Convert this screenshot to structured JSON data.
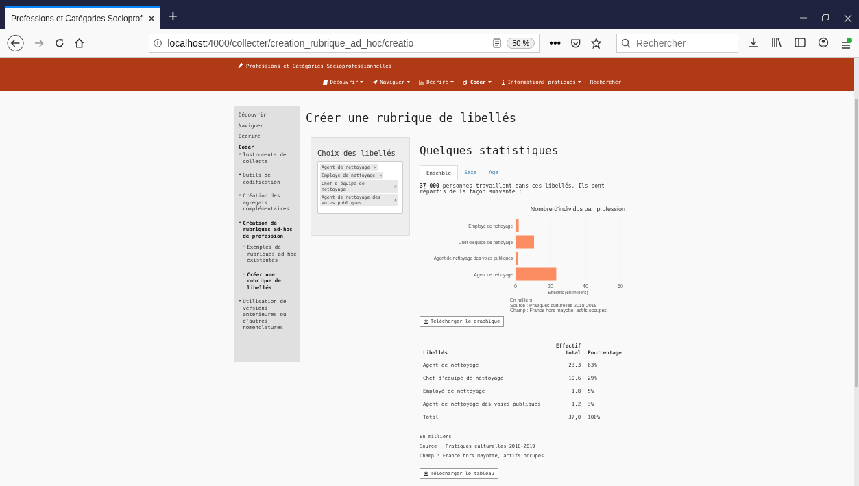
{
  "browser": {
    "tab_title": "Professions et Catégories Socioprof",
    "new_tab": "+",
    "url_host": "localhost",
    "url_rest": ":4000/collecter/creation_rubrique_ad_hoc/creatio",
    "zoom": "50 %",
    "more": "•••",
    "search": {
      "placeholder": "Rechercher"
    }
  },
  "header": {
    "brand": "Professions et Catégories Socioprofessionnelles",
    "nav": [
      {
        "label": "Découvrir",
        "kind": "book",
        "dropdown": true,
        "selected": false
      },
      {
        "label": "Naviguer",
        "kind": "send",
        "dropdown": true,
        "selected": false
      },
      {
        "label": "Décrire",
        "kind": "chart",
        "dropdown": true,
        "selected": false
      },
      {
        "label": "Coder",
        "kind": "gears",
        "dropdown": true,
        "selected": true
      },
      {
        "label": "Informations pratiques",
        "kind": "info",
        "dropdown": true,
        "selected": false
      },
      {
        "label": "Rechercher",
        "kind": "none",
        "dropdown": false,
        "selected": false
      }
    ]
  },
  "sidebar": {
    "items": [
      {
        "label": "Découvrir",
        "selected": false
      },
      {
        "label": "Naviguer",
        "selected": false
      },
      {
        "label": "Décrire",
        "selected": false
      },
      {
        "label": "Coder",
        "selected": true,
        "children": [
          {
            "bullet": "•",
            "label": "Instruments de collecte",
            "selected": false
          },
          {
            "bullet": "•",
            "label": "Outils de codification",
            "selected": false
          },
          {
            "bullet": "•",
            "label": "Création des agrégats complémentaires",
            "selected": false
          },
          {
            "bullet": "•",
            "label": "Création de rubriques ad-hoc de profession",
            "selected": true,
            "children": [
              {
                "bullet": "◦",
                "label": "Exemples de rubriques ad hoc existantes",
                "selected": false
              },
              {
                "bullet": "◦",
                "label": "Créer une rubrique de libellés",
                "selected": true
              }
            ]
          },
          {
            "bullet": "•",
            "label": "Utilisation de versions antérieures ou d'autres nomenclatures",
            "selected": false
          }
        ]
      }
    ]
  },
  "page_title": "Créer une rubrique de libellés",
  "choice_panel": {
    "title": "Choix des libellés",
    "tags": [
      {
        "label": "Agent de nettoyage",
        "remove": "×"
      },
      {
        "label": "Employé de nettoyage",
        "remove": "×"
      },
      {
        "label": "Chef d'équipe de nettoyage",
        "remove": "×"
      },
      {
        "label": "Agent de nettoyage des voies publiques",
        "remove": "×"
      }
    ]
  },
  "stats": {
    "title": "Quelques statistiques",
    "tabs": [
      {
        "label": "Ensemble",
        "selected": true
      },
      {
        "label": "Sexe",
        "selected": false
      },
      {
        "label": "Age",
        "selected": false
      }
    ],
    "summary": "**37 000** personnes travaillent dans ces libellés. Ils sont répartis de la façon suivante :",
    "chart_data": {
      "type": "bar",
      "orientation": "horizontal",
      "title": "Nombre d'individus par  profession",
      "xlabel": "Effectifs (en milliers)",
      "categories": [
        "Employé de nettoyage",
        "Chef d'équipe de nettoyage",
        "Agent de nettoyage des voies publiques",
        "Agent de nettoyage"
      ],
      "series": [
        {
          "color": "#fc8d62",
          "values": [
            1.8,
            10.6,
            1.2,
            23.3
          ]
        }
      ],
      "xlim": [
        0,
        60
      ],
      "xticks": [
        0,
        20,
        40,
        60
      ]
    },
    "chart_notes": [
      "En milliers",
      "Source : Pratiques culturelles 2018-2019",
      "Champ : France hors mayotte, actifs occupés"
    ],
    "chart_download": "Télécharger le graphique",
    "table": {
      "columns": [
        "Libellés",
        "Effectif total",
        "Pourcentage"
      ],
      "rows": [
        [
          "Agent de nettoyage",
          "23,3",
          "63%"
        ],
        [
          "Chef d'équipe de nettoyage",
          "10,6",
          "29%"
        ],
        [
          "Employé de nettoyage",
          "1,8",
          "5%"
        ],
        [
          "Agent de nettoyage des voies publiques",
          "1,2",
          "3%"
        ],
        [
          "Total",
          "37,0",
          "100%"
        ]
      ]
    },
    "table_notes": [
      "En milliers",
      "Source : Pratiques culturelles 2018-2019",
      "Champ : France hors mayotte, actifs occupés"
    ],
    "table_download": "Télécharger le tableau"
  }
}
